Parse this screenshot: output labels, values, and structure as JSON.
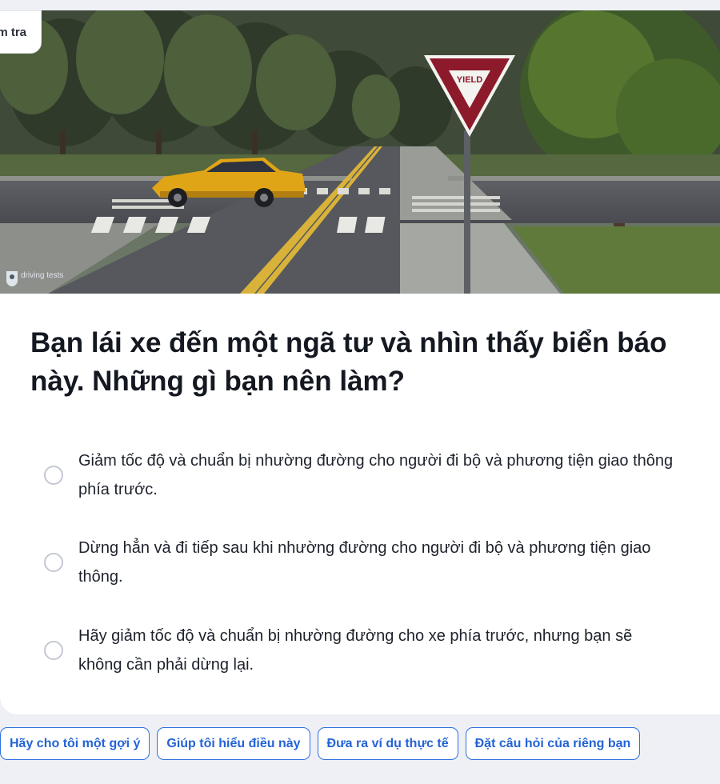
{
  "header": {
    "badge_label": "m tra"
  },
  "image": {
    "sign_text": "YIELD",
    "watermark_text": "driving tests",
    "watermark_icon": "driving-tests-logo-icon"
  },
  "question": {
    "text": "Bạn lái xe đến một ngã tư và nhìn thấy biển báo này. Những gì bạn nên làm?"
  },
  "options": [
    {
      "text": "Giảm tốc độ và chuẩn bị nhường đường cho người đi bộ và phương tiện giao thông phía trước."
    },
    {
      "text": "Dừng hẳn và đi tiếp sau khi nhường đường cho người đi bộ và phương tiện giao thông."
    },
    {
      "text": "Hãy giảm tốc độ và chuẩn bị nhường đường cho xe phía trước, nhưng bạn sẽ không cần phải dừng lại."
    }
  ],
  "actions": {
    "hint": "Hãy cho tôi một gợi ý",
    "explain": "Giúp tôi hiểu điều này",
    "example": "Đưa ra ví dụ thực tế",
    "ask": "Đặt câu hỏi của riêng bạn"
  },
  "colors": {
    "accent": "#2f6fde",
    "page_background": "#eef0f6",
    "sign_red": "#8c1a2a"
  }
}
